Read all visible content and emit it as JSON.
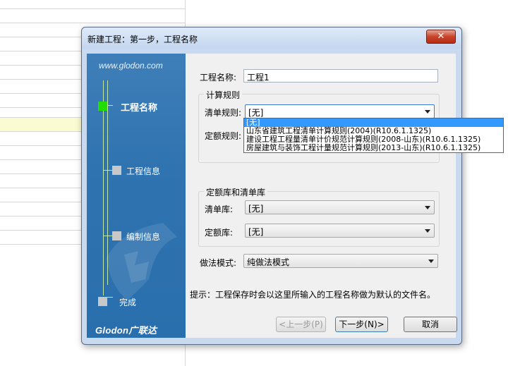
{
  "dialog": {
    "title": "新建工程：第一步，工程名称",
    "close_label": "✕"
  },
  "sidebar": {
    "url": "www.glodon.com",
    "steps": [
      {
        "label": "工程名称",
        "active": true
      },
      {
        "label": "工程信息",
        "active": false
      },
      {
        "label": "编制信息",
        "active": false
      },
      {
        "label": "完成",
        "active": false
      }
    ],
    "logo": "Glodon广联达",
    "colors": {
      "active": "#22dd00",
      "inactive": "#c8c8c8",
      "panel": "#2f73b0"
    }
  },
  "form": {
    "project_name_label": "工程名称:",
    "project_name_value": "工程1",
    "calc_rules_group": "计算规则",
    "bill_rule_label": "清单规则:",
    "bill_rule_value": "[无]",
    "quota_rule_label": "定额规则:",
    "libs_group": "定额库和清单库",
    "bill_lib_label": "清单库:",
    "bill_lib_value": "[无]",
    "quota_lib_label": "定额库:",
    "quota_lib_value": "[无]",
    "mode_label": "做法模式:",
    "mode_value": "纯做法模式",
    "hint": "提示：工程保存时会以这里所输入的工程名称做为默认的文件名。"
  },
  "dropdown": {
    "items": [
      {
        "label": "[无]",
        "selected": true
      },
      {
        "label": "山东省建筑工程清单计算规则(2004)(R10.6.1.1325)",
        "selected": false
      },
      {
        "label": "建设工程工程量清单计价规范计算规则(2008-山东)(R10.6.1.1325)",
        "selected": false
      },
      {
        "label": "房屋建筑与装饰工程计量规范计算规则(2013-山东)(R10.6.1.1325)",
        "selected": false
      }
    ]
  },
  "buttons": {
    "prev": "<上一步(P)",
    "next": "下一步(N)>",
    "cancel": "取消"
  }
}
